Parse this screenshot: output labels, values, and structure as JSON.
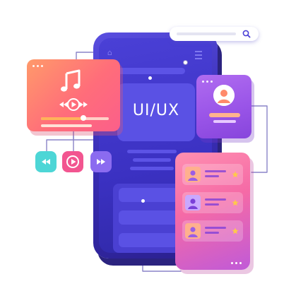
{
  "phone": {
    "hero_label": "UI/UX"
  },
  "music_player": {
    "progress": 0.62
  },
  "colors": {
    "phone": "#3b31c2",
    "music_card": "#ff6d7a",
    "profile_card": "#9a55e8",
    "list_card": "#f56aa6",
    "rewind_button": "#4dd6d6",
    "play_button": "#f25590",
    "forward_button": "#8b6bf0"
  },
  "icons": {
    "search": "search-icon",
    "music": "music-note-icon",
    "home": "home-icon",
    "menu": "menu-icon",
    "rewind": "rewind-icon",
    "play": "play-icon",
    "forward": "fast-forward-icon",
    "avatar": "user-avatar-icon",
    "star": "star-icon"
  }
}
